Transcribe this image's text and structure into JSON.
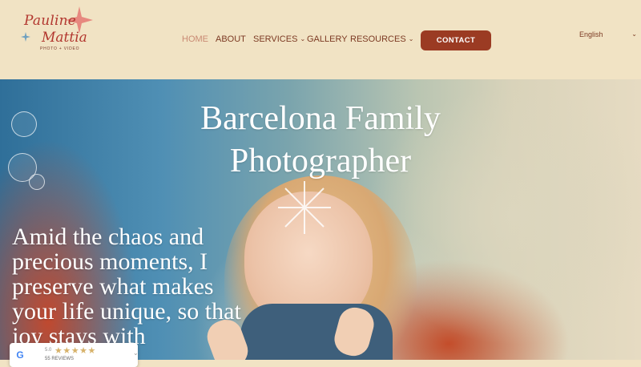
{
  "brand": {
    "logo_line1": "Pauline",
    "logo_line2": "Mattia",
    "logo_sub": "PHOTO + VIDEO"
  },
  "nav": {
    "items": [
      {
        "label": "HOME",
        "active": true
      },
      {
        "label": "ABOUT"
      },
      {
        "label": "SERVICES",
        "dropdown": true
      },
      {
        "label": "GALLERY"
      },
      {
        "label": "RESOURCES",
        "dropdown": true
      }
    ],
    "contact_label": "CONTACT",
    "language": "English"
  },
  "hero": {
    "title_line1": "Barcelona Family",
    "title_line2": "Photographer",
    "text": "Amid the chaos and precious moments, I preserve what makes your life unique, so that joy stays with"
  },
  "review_badge": {
    "rating": "5.0",
    "stars": "★★★★★",
    "count": "55 REVIEWS",
    "icon": "google-icon"
  },
  "colors": {
    "header_bg": "#f1e3c4",
    "nav_text": "#7c3a23",
    "nav_active": "#c98a73",
    "button_bg": "#9b3b23",
    "logo_red": "#b2372f",
    "star_pink": "#e7887f"
  }
}
